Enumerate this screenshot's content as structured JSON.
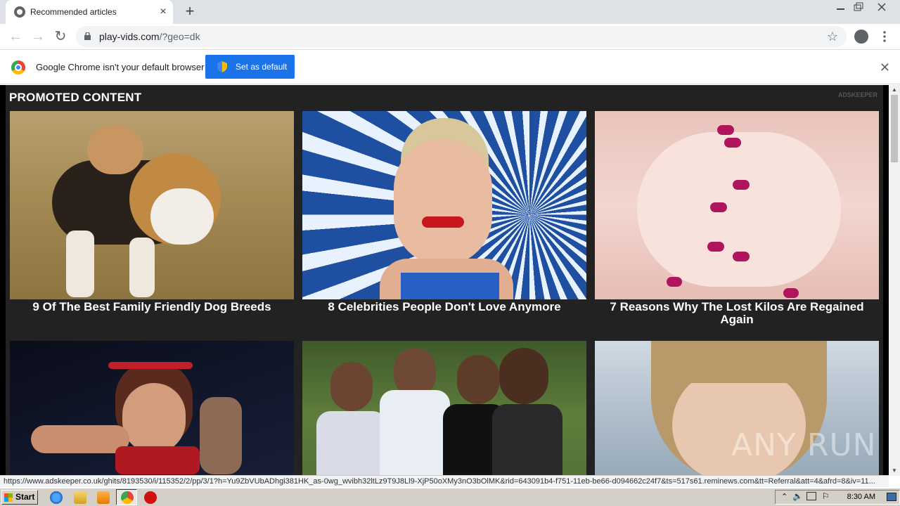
{
  "tab": {
    "title": "Recommended articles"
  },
  "address": {
    "domain": "play-vids.com",
    "path": "/?geo=dk"
  },
  "infobar": {
    "message": "Google Chrome isn't your default browser",
    "button": "Set as default"
  },
  "promo": {
    "heading": "PROMOTED CONTENT",
    "brand": "ADSKEEPER",
    "cards": [
      {
        "title": "9 Of The Best Family Friendly Dog Breeds"
      },
      {
        "title": "8 Celebrities People Don't Love Anymore"
      },
      {
        "title": "7 Reasons Why The Lost Kilos Are Regained Again"
      },
      {
        "title": ""
      },
      {
        "title": ""
      },
      {
        "title": ""
      }
    ]
  },
  "status_url": "https://www.adskeeper.co.uk/ghits/8193530/i/115352/2/pp/3/1?h=Yu9ZbVUbADhgi381HK_as-0wg_wvibh32ltLz9T9J8Ll9-XjP50oXMy3nO3bOlMK&rid=643091b4-f751-11eb-be66-d094662c24f7&ts=517s61.reminews.com&tt=Referral&att=4&afrd=8&iv=11...",
  "taskbar": {
    "start": "Start",
    "clock": "8:30 AM"
  },
  "watermark": "ANY RUN",
  "colors": {
    "accent": "#1a73e8",
    "page_bg": "#222222"
  }
}
